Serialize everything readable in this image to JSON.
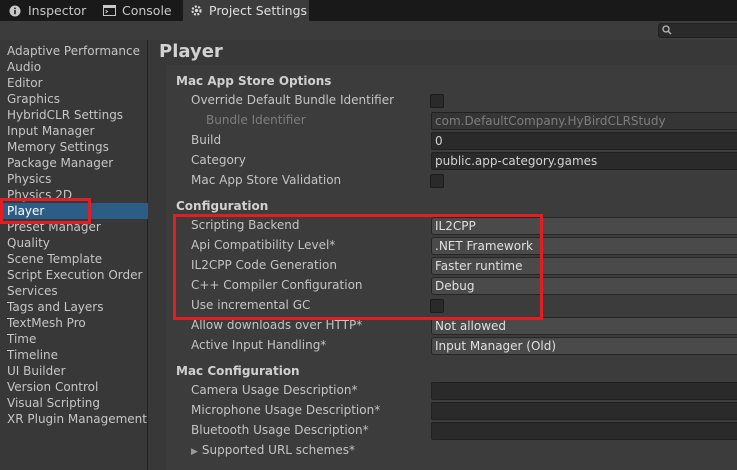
{
  "tabs": [
    {
      "label": "Inspector",
      "icon": "info-icon"
    },
    {
      "label": "Console",
      "icon": "console-icon"
    },
    {
      "label": "Project Settings",
      "icon": "gear-icon"
    }
  ],
  "search": {
    "icon": "search-icon",
    "value": ""
  },
  "sidebar": {
    "items": [
      {
        "label": "Adaptive Performance"
      },
      {
        "label": "Audio"
      },
      {
        "label": "Editor"
      },
      {
        "label": "Graphics"
      },
      {
        "label": "HybridCLR Settings"
      },
      {
        "label": "Input Manager"
      },
      {
        "label": "Memory Settings"
      },
      {
        "label": "Package Manager"
      },
      {
        "label": "Physics"
      },
      {
        "label": "Physics 2D"
      },
      {
        "label": "Player"
      },
      {
        "label": "Preset Manager"
      },
      {
        "label": "Quality"
      },
      {
        "label": "Scene Template"
      },
      {
        "label": "Script Execution Order"
      },
      {
        "label": "Services"
      },
      {
        "label": "Tags and Layers"
      },
      {
        "label": "TextMesh Pro"
      },
      {
        "label": "Time"
      },
      {
        "label": "Timeline"
      },
      {
        "label": "UI Builder"
      },
      {
        "label": "Version Control"
      },
      {
        "label": "Visual Scripting"
      },
      {
        "label": "XR Plugin Management"
      }
    ],
    "selected": "Player"
  },
  "main": {
    "title": "Player",
    "mac_app_store": {
      "header": "Mac App Store Options",
      "override_label": "Override Default Bundle Identifier",
      "override_checked": false,
      "bundle_label": "Bundle Identifier",
      "bundle_value": "com.DefaultCompany.HyBirdCLRStudy",
      "build_label": "Build",
      "build_value": "0",
      "category_label": "Category",
      "category_value": "public.app-category.games",
      "validation_label": "Mac App Store Validation",
      "validation_checked": false
    },
    "configuration": {
      "header": "Configuration",
      "scripting_backend_label": "Scripting Backend",
      "scripting_backend_value": "IL2CPP",
      "api_label": "Api Compatibility Level*",
      "api_value": ".NET Framework",
      "il2cpp_codegen_label": "IL2CPP Code Generation",
      "il2cpp_codegen_value": "Faster runtime",
      "cpp_compiler_label": "C++ Compiler Configuration",
      "cpp_compiler_value": "Debug",
      "incremental_gc_label": "Use incremental GC",
      "incremental_gc_checked": false,
      "downloads_label": "Allow downloads over HTTP*",
      "downloads_value": "Not allowed",
      "input_handling_label": "Active Input Handling*",
      "input_handling_value": "Input Manager (Old)"
    },
    "mac_configuration": {
      "header": "Mac Configuration",
      "camera_label": "Camera Usage Description*",
      "camera_value": "",
      "microphone_label": "Microphone Usage Description*",
      "microphone_value": "",
      "bluetooth_label": "Bluetooth Usage Description*",
      "bluetooth_value": "",
      "url_schemes_label": "Supported URL schemes*"
    }
  },
  "colors": {
    "selection": "#2c5d87",
    "highlight": "#e01e24",
    "background": "#3c3c3c"
  }
}
